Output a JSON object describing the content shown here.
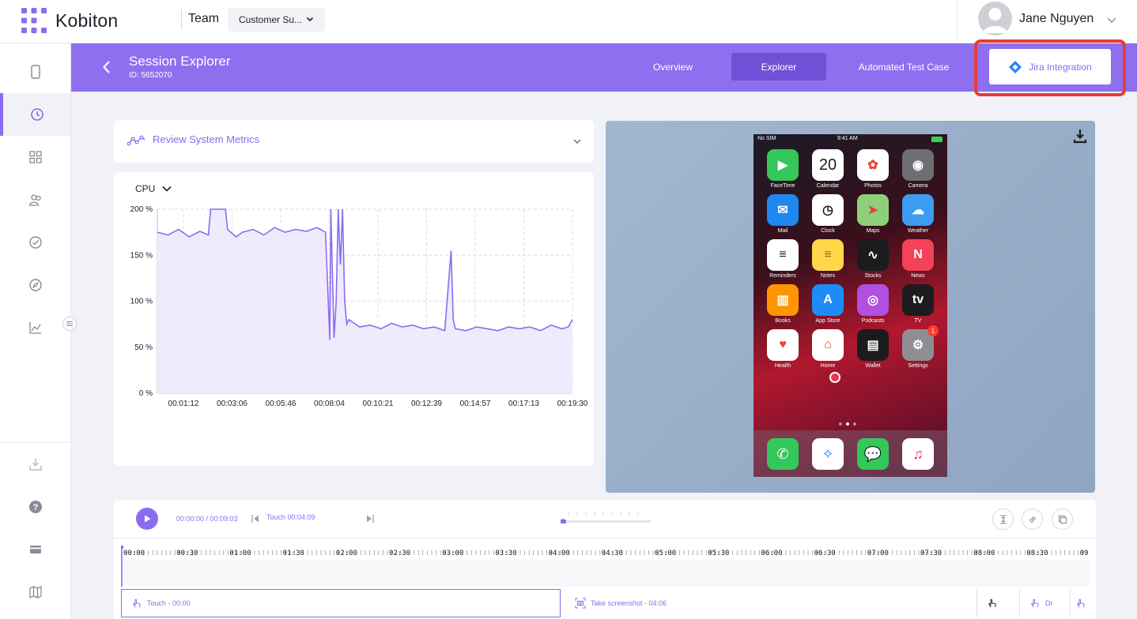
{
  "header": {
    "brand": "Kobiton",
    "team_label": "Team",
    "team_value": "Customer Su...",
    "user_name": "Jane Nguyen"
  },
  "sidebar": {
    "items": [
      {
        "icon": "device-icon"
      },
      {
        "icon": "clock-icon",
        "active": true
      },
      {
        "icon": "grid-icon"
      },
      {
        "icon": "users-icon"
      },
      {
        "icon": "check-circle-icon"
      },
      {
        "icon": "compass-icon"
      },
      {
        "icon": "chart-icon"
      }
    ],
    "bottom_items": [
      {
        "icon": "download-tray-icon"
      },
      {
        "icon": "help-icon"
      },
      {
        "icon": "card-icon"
      },
      {
        "icon": "map-icon"
      }
    ]
  },
  "session_bar": {
    "title": "Session Explorer",
    "id_text": "ID: 5652070",
    "tabs": [
      "Overview",
      "Explorer",
      "Automated Test Case"
    ],
    "active_tab": "Explorer",
    "jira_button": "Jira Integration",
    "highlight_color": "#e83b3b"
  },
  "metrics": {
    "header_label": "Review System Metrics",
    "metric_select": "CPU"
  },
  "chart_data": {
    "type": "area",
    "title": "",
    "xlabel": "",
    "ylabel": "",
    "y_ticks": [
      "0 %",
      "50 %",
      "100 %",
      "150 %",
      "200 %"
    ],
    "ylim": [
      0,
      200
    ],
    "x_ticks": [
      "00:01:12",
      "00:03:06",
      "00:05:46",
      "00:08:04",
      "00:10:21",
      "00:12:39",
      "00:14:57",
      "00:17:13",
      "00:19:30"
    ],
    "series": [
      {
        "color": "#8b6cf0",
        "x_minutes": [
          0,
          0.5,
          1,
          1.5,
          2,
          2.4,
          2.5,
          3.2,
          3.3,
          3.7,
          4.0,
          4.5,
          5,
          5.5,
          6,
          6.5,
          7,
          7.5,
          7.9,
          8.1,
          8.15,
          8.3,
          8.4,
          8.5,
          8.6,
          8.7,
          8.8,
          8.9,
          9.0,
          9.5,
          10,
          10.5,
          11,
          11.5,
          12,
          12.5,
          13,
          13.5,
          13.8,
          13.9,
          14.0,
          14.5,
          15,
          15.5,
          16,
          16.5,
          17,
          17.5,
          18,
          18.5,
          19,
          19.3,
          19.5
        ],
        "values": [
          175,
          172,
          178,
          170,
          176,
          172,
          200,
          200,
          178,
          170,
          175,
          178,
          172,
          180,
          175,
          178,
          176,
          180,
          175,
          58,
          200,
          60,
          100,
          200,
          140,
          200,
          100,
          75,
          80,
          72,
          74,
          70,
          76,
          72,
          74,
          70,
          72,
          68,
          155,
          80,
          70,
          68,
          72,
          70,
          68,
          72,
          70,
          72,
          68,
          74,
          70,
          72,
          80
        ]
      }
    ]
  },
  "device": {
    "status_left": "No SIM",
    "status_time": "9:41 AM",
    "apps": [
      {
        "name": "FaceTime",
        "color": "#34c759",
        "glyph": "▶"
      },
      {
        "name": "Calendar",
        "color": "#ffffff",
        "glyph": "20"
      },
      {
        "name": "Photos",
        "color": "#ffffff",
        "glyph": "✿"
      },
      {
        "name": "Camera",
        "color": "#6e6e73",
        "glyph": "◉"
      },
      {
        "name": "Mail",
        "color": "#1e88f0",
        "glyph": "✉"
      },
      {
        "name": "Clock",
        "color": "#ffffff",
        "glyph": "◷"
      },
      {
        "name": "Maps",
        "color": "#8ed07a",
        "glyph": "➤"
      },
      {
        "name": "Weather",
        "color": "#3b9cf0",
        "glyph": "☁"
      },
      {
        "name": "Reminders",
        "color": "#ffffff",
        "glyph": "≡"
      },
      {
        "name": "Notes",
        "color": "#ffd84a",
        "glyph": "≡"
      },
      {
        "name": "Stocks",
        "color": "#1c1c1e",
        "glyph": "∿"
      },
      {
        "name": "News",
        "color": "#f44258",
        "glyph": "N"
      },
      {
        "name": "Books",
        "color": "#ff9500",
        "glyph": "▥"
      },
      {
        "name": "App Store",
        "color": "#1d8cf8",
        "glyph": "A"
      },
      {
        "name": "Podcasts",
        "color": "#b04fe0",
        "glyph": "◎"
      },
      {
        "name": "TV",
        "color": "#1c1c1e",
        "glyph": "tv"
      },
      {
        "name": "Health",
        "color": "#ffffff",
        "glyph": "♥"
      },
      {
        "name": "Home",
        "color": "#ffffff",
        "glyph": "⌂"
      },
      {
        "name": "Wallet",
        "color": "#1c1c1e",
        "glyph": "▤"
      },
      {
        "name": "Settings",
        "color": "#8e8e93",
        "glyph": "⚙"
      }
    ],
    "settings_badge": "1",
    "dock": [
      {
        "name": "phone",
        "color": "#34c759",
        "glyph": "✆"
      },
      {
        "name": "safari",
        "color": "#ffffff",
        "glyph": "✧"
      },
      {
        "name": "messages",
        "color": "#34c759",
        "glyph": "💬"
      },
      {
        "name": "music",
        "color": "#ffffff",
        "glyph": "♫"
      }
    ]
  },
  "timeline": {
    "time_text": "00:00:00 / 00:09:03",
    "touch_label": "Touch 00:04:09",
    "ruler": [
      "00:00",
      "00:30",
      "01:00",
      "01:30",
      "02:00",
      "02:30",
      "03:00",
      "03:30",
      "04:00",
      "04:30",
      "05:00",
      "05:30",
      "06:00",
      "06:30",
      "07:00",
      "07:30",
      "08:00",
      "08:30",
      "09"
    ],
    "events": [
      {
        "label": "Touch - 00:00",
        "icon": "touch-icon"
      },
      {
        "label": "Take screenshot - 04:06",
        "icon": "screenshot-icon"
      },
      {
        "label": "Dr",
        "icon": "touch-icon"
      }
    ]
  }
}
